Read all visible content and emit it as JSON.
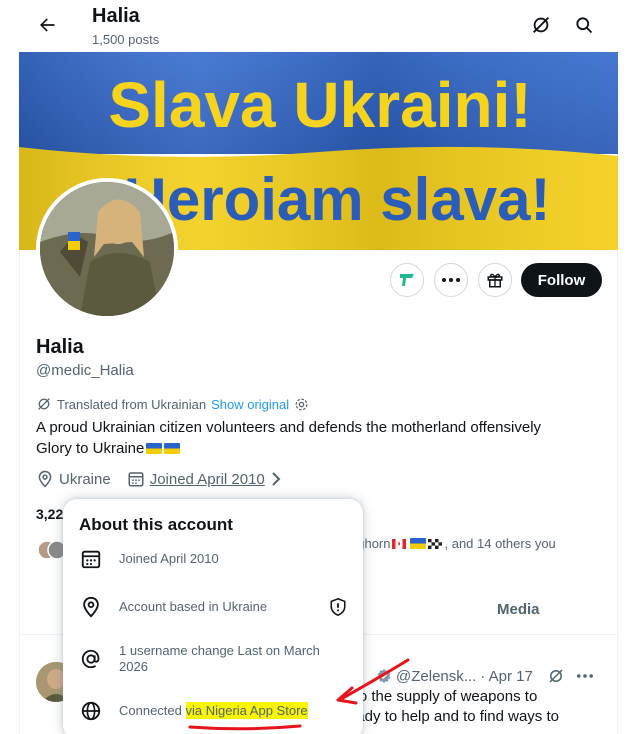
{
  "header": {
    "name": "Halia",
    "posts": "1,500 posts",
    "back_icon": "back-arrow-icon",
    "grok_icon": "grok-icon",
    "search_icon": "search-icon"
  },
  "banner": {
    "line1": "Slava Ukraini!",
    "line2": "Heroiam slava!",
    "colors": {
      "blue": "#2f64c4",
      "yellow": "#f5d018",
      "text_yellow": "#f7d31c",
      "text_blue": "#2b5bb8"
    }
  },
  "profile": {
    "name": "Halia",
    "handle": "@medic_Halia",
    "translated_label": "Translated from Ukrainian",
    "show_original": "Show original",
    "bio_line1": "A proud Ukrainian citizen volunteers and defends the motherland offensively",
    "bio_line2": "Glory to Ukraine",
    "location": "Ukraine",
    "joined": "Joined April 2010",
    "count_partial": "3,22",
    "followers_known": "nghorn",
    "followers_known_suffix": ", and 14 others you"
  },
  "actions": {
    "follow": "Follow"
  },
  "tabs": {
    "media": "Media"
  },
  "about_popup": {
    "title": "About this account",
    "joined": "Joined April 2010",
    "based": "Account based in Ukraine",
    "username_change": "1 username change Last on March 2026",
    "connected_prefix": "Connected ",
    "connected_highlight": "via Nigeria App Store"
  },
  "tweet": {
    "handle": "@Zelensk...",
    "date": "· Apr 17",
    "line1": "s to the supply of weapons to",
    "line2": "ready to help and to find ways to"
  }
}
